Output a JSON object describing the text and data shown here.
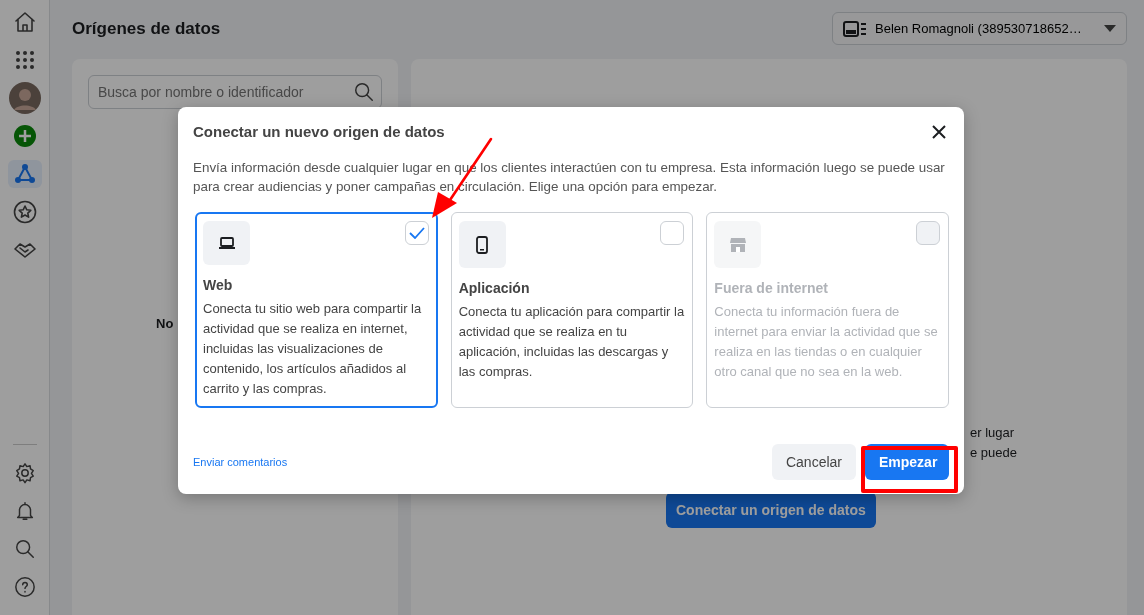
{
  "sidebar": {
    "top_items": [
      {
        "kind": "home",
        "selected": false
      },
      {
        "kind": "grid",
        "selected": false
      },
      {
        "kind": "avatar",
        "selected": false
      },
      {
        "kind": "create",
        "selected": false
      },
      {
        "kind": "network",
        "selected": true
      },
      {
        "kind": "star",
        "selected": false
      },
      {
        "kind": "handshake",
        "selected": false
      }
    ],
    "bottom_items": [
      {
        "kind": "settings",
        "selected": false
      },
      {
        "kind": "bell",
        "selected": false
      },
      {
        "kind": "search",
        "selected": false
      },
      {
        "kind": "help",
        "selected": false
      }
    ]
  },
  "page_title": "Orígenes de datos",
  "account_selector": {
    "value": "Belen Romagnoli (389530718652…"
  },
  "left_panel": {
    "search": {
      "placeholder": "Busca por nombre o identificador"
    },
    "empty_text": "No"
  },
  "right_panel": {
    "text_lines": [
      "er lugar",
      "e puede"
    ],
    "button": "Conectar un origen de datos"
  },
  "dialog": {
    "title": "Conectar un nuevo origen de datos",
    "intro": "Envía información desde cualquier lugar en que los clientes interactúen con tu empresa. Esta información luego se puede usar para crear audiencias y poner campañas en circulación. Elige una opción para empezar.",
    "options": [
      {
        "kind": "laptop",
        "title": "Web",
        "description": "Conecta tu sitio web para compartir la actividad que se realiza en internet, incluidas las visualizaciones de contenido, los artículos añadidos al carrito y las compras.",
        "selected": true,
        "disabled": false
      },
      {
        "kind": "phone",
        "title": "Aplicación",
        "description": "Conecta tu aplicación para compartir la actividad que se realiza en tu aplicación, incluidas las descargas y las compras.",
        "selected": false,
        "disabled": false
      },
      {
        "kind": "store",
        "title": "Fuera de internet",
        "description": "Conecta tu información fuera de internet para enviar la actividad que se realiza en las tiendas o en cualquier otro canal que no sea en la web.",
        "selected": false,
        "disabled": true
      }
    ],
    "feedback_link": "Enviar comentarios",
    "cancel_button": "Cancelar",
    "primary_button": "Empezar"
  }
}
